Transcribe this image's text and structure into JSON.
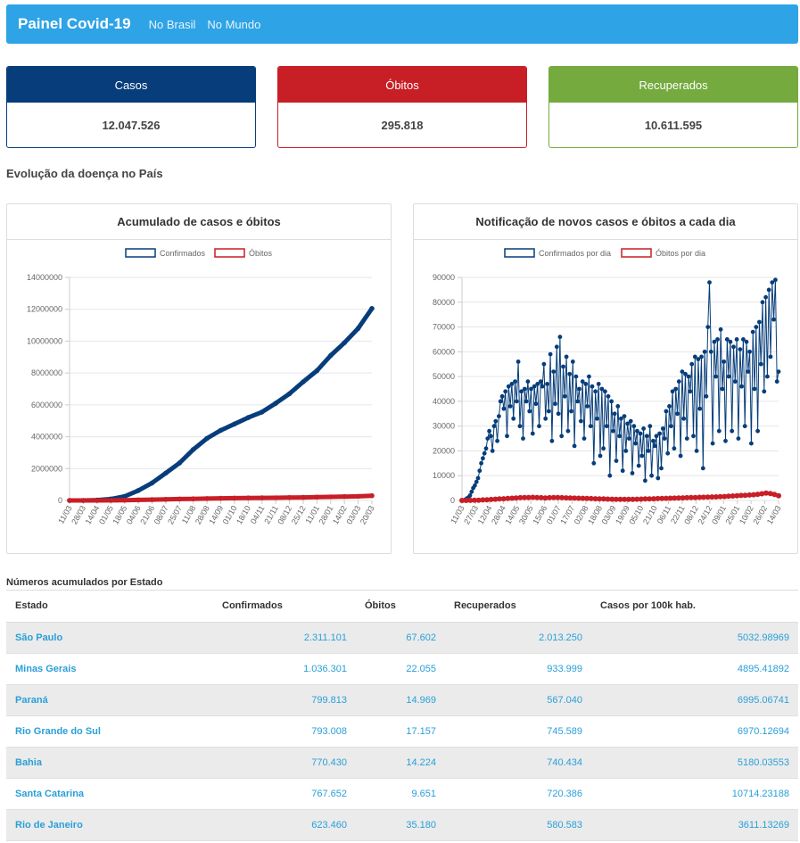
{
  "nav": {
    "brand": "Painel Covid-19",
    "links": [
      "No Brasil",
      "No Mundo"
    ]
  },
  "cards": [
    {
      "label": "Casos",
      "value": "12.047.526",
      "color": "#063d7a"
    },
    {
      "label": "Óbitos",
      "value": "295.818",
      "color": "#c81e26"
    },
    {
      "label": "Recuperados",
      "value": "10.611.595",
      "color": "#74aa3e"
    }
  ],
  "section_title": "Evolução da doença no País",
  "chart_data": [
    {
      "type": "line",
      "title": "Acumulado de casos e óbitos",
      "legend_position": "top",
      "grid": true,
      "ylim": [
        0,
        14000000
      ],
      "yticks": [
        "0",
        "2000000",
        "4000000",
        "6000000",
        "8000000",
        "10000000",
        "12000000",
        "14000000"
      ],
      "xtick_labels": [
        "11/03",
        "28/03",
        "14/04",
        "01/05",
        "18/05",
        "04/06",
        "21/06",
        "08/07",
        "25/07",
        "11/08",
        "28/08",
        "14/09",
        "01/10",
        "18/10",
        "04/11",
        "21/11",
        "08/12",
        "25/12",
        "11/01",
        "28/01",
        "14/02",
        "03/03",
        "20/03"
      ],
      "series": [
        {
          "name": "Confirmados",
          "color": "#063d7a",
          "values": [
            0,
            0,
            20000,
            90000,
            250000,
            620000,
            1100000,
            1720000,
            2350000,
            3200000,
            3900000,
            4400000,
            4800000,
            5200000,
            5550000,
            6100000,
            6700000,
            7450000,
            8150000,
            9100000,
            9900000,
            10800000,
            12050000
          ]
        },
        {
          "name": "Óbitos",
          "color": "#c81e26",
          "values": [
            0,
            100,
            1500,
            6000,
            17000,
            35000,
            53000,
            70000,
            87000,
            103000,
            120000,
            133000,
            145000,
            155000,
            162000,
            170000,
            180000,
            192000,
            205000,
            222000,
            240000,
            258000,
            295818
          ]
        }
      ]
    },
    {
      "type": "line",
      "title": "Notificação de novos casos e óbitos a cada dia",
      "legend_position": "top",
      "grid": true,
      "ylim": [
        0,
        90000
      ],
      "yticks": [
        "0",
        "10000",
        "20000",
        "30000",
        "40000",
        "50000",
        "60000",
        "70000",
        "80000",
        "90000"
      ],
      "xtick_labels": [
        "11/03",
        "27/03",
        "12/04",
        "28/04",
        "14/05",
        "30/05",
        "15/06",
        "01/07",
        "17/07",
        "02/08",
        "18/08",
        "03/09",
        "19/09",
        "05/10",
        "21/10",
        "06/11",
        "22/11",
        "08/12",
        "24/12",
        "09/01",
        "25/01",
        "10/02",
        "26/02",
        "14/03"
      ],
      "series": [
        {
          "name": "Confirmados por dia",
          "color": "#063d7a",
          "values": [
            0,
            50,
            300,
            800,
            1200,
            2000,
            3500,
            5000,
            6000,
            7500,
            9000,
            12000,
            15000,
            17000,
            19000,
            21000,
            25000,
            28000,
            26000,
            20000,
            30000,
            32000,
            24000,
            34000,
            40000,
            42000,
            37000,
            44000,
            26000,
            46000,
            38000,
            47000,
            33000,
            48000,
            40000,
            56000,
            30000,
            44000,
            25000,
            45000,
            40000,
            48000,
            36000,
            45000,
            27000,
            46000,
            39000,
            47000,
            30000,
            48000,
            46000,
            55000,
            33000,
            47000,
            36000,
            59000,
            24000,
            52000,
            39000,
            62000,
            35000,
            66000,
            26000,
            54000,
            42000,
            58000,
            28000,
            51000,
            36000,
            56000,
            22000,
            50000,
            40000,
            45000,
            32000,
            48000,
            25000,
            47000,
            38000,
            50000,
            30000,
            46000,
            15000,
            44000,
            33000,
            47000,
            18000,
            45000,
            21000,
            44000,
            30000,
            42000,
            10000,
            40000,
            28000,
            35000,
            16000,
            38000,
            26000,
            33000,
            12000,
            34000,
            20000,
            31000,
            25000,
            32000,
            11000,
            30000,
            23000,
            28000,
            14000,
            27000,
            18000,
            29000,
            8000,
            26000,
            20000,
            30000,
            10000,
            24000,
            22000,
            26000,
            9000,
            27000,
            13000,
            29000,
            25000,
            36000,
            19000,
            38000,
            30000,
            44000,
            21000,
            45000,
            35000,
            48000,
            18000,
            52000,
            33000,
            51000,
            25000,
            50000,
            44000,
            55000,
            26000,
            58000,
            20000,
            57000,
            37000,
            58000,
            13000,
            60000,
            42000,
            70000,
            88000,
            60000,
            23000,
            64000,
            50000,
            65000,
            28000,
            69000,
            45000,
            56000,
            24000,
            65000,
            50000,
            64000,
            28000,
            62000,
            48000,
            65000,
            25000,
            61000,
            46000,
            65000,
            30000,
            64000,
            52000,
            60000,
            23000,
            68000,
            45000,
            70000,
            28000,
            72000,
            55000,
            80000,
            44000,
            82000,
            50000,
            85000,
            58000,
            88000,
            73000,
            89000,
            48000,
            52000
          ]
        },
        {
          "name": "Óbitos por dia",
          "color": "#c81e26",
          "values": [
            0,
            0,
            20,
            60,
            100,
            200,
            300,
            400,
            500,
            600,
            700,
            800,
            900,
            1000,
            1100,
            1150,
            1200,
            1250,
            1200,
            1100,
            1000,
            1100,
            1200,
            1150,
            1100,
            1050,
            1000,
            950,
            900,
            850,
            800,
            750,
            700,
            650,
            600,
            550,
            500,
            480,
            460,
            450,
            440,
            450,
            500,
            550,
            600,
            650,
            700,
            750,
            800,
            850,
            900,
            950,
            1000,
            1050,
            1100,
            1150,
            1200,
            1250,
            1300,
            1350,
            1400,
            1450,
            1500,
            1600,
            1700,
            1800,
            1900,
            2000,
            2100,
            2200,
            2300,
            2500,
            2700,
            3000,
            2800,
            2400,
            1900
          ]
        }
      ]
    }
  ],
  "table": {
    "title": "Números acumulados por Estado",
    "headers": [
      "Estado",
      "Confirmados",
      "Óbitos",
      "Recuperados",
      "Casos por 100k hab."
    ],
    "rows": [
      [
        "São Paulo",
        "2.311.101",
        "67.602",
        "2.013.250",
        "5032.98969"
      ],
      [
        "Minas Gerais",
        "1.036.301",
        "22.055",
        "933.999",
        "4895.41892"
      ],
      [
        "Paraná",
        "799.813",
        "14.969",
        "567.040",
        "6995.06741"
      ],
      [
        "Rio Grande do Sul",
        "793.008",
        "17.157",
        "745.589",
        "6970.12694"
      ],
      [
        "Bahia",
        "770.430",
        "14.224",
        "740.434",
        "5180.03553"
      ],
      [
        "Santa Catarina",
        "767.652",
        "9.651",
        "720.386",
        "10714.23188"
      ],
      [
        "Rio de Janeiro",
        "623.460",
        "35.180",
        "580.583",
        "3611.13269"
      ]
    ]
  }
}
